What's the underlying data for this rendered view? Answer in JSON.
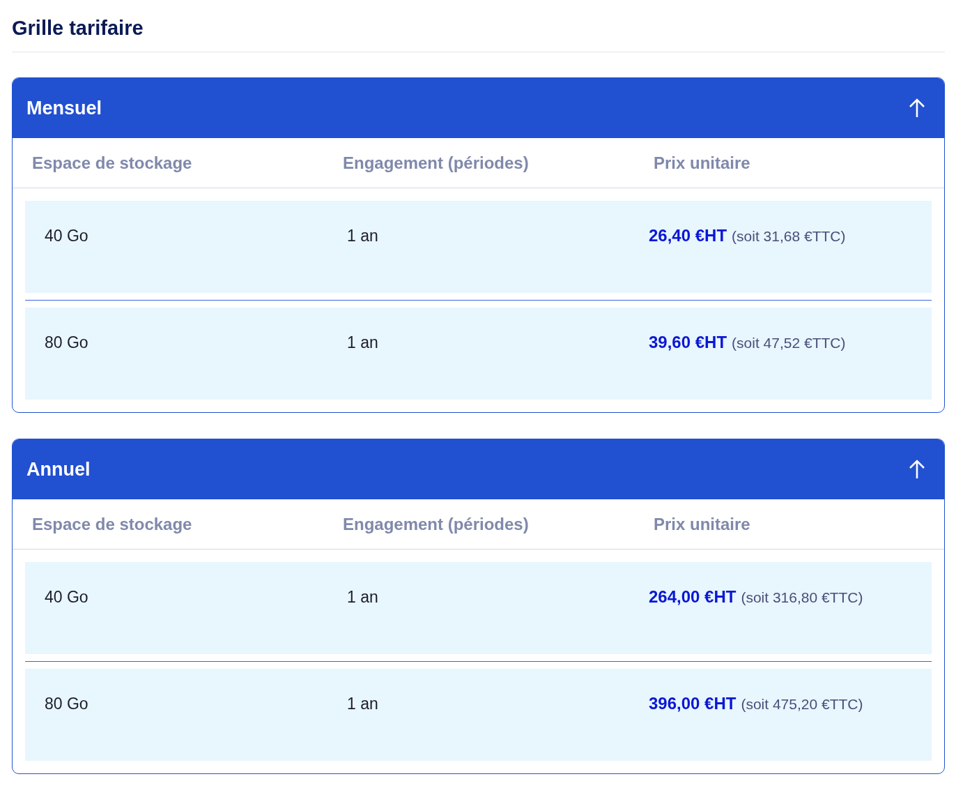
{
  "title": "Grille tarifaire",
  "panels": [
    {
      "title": "Mensuel",
      "expanded": true,
      "columns": [
        "Espace de stockage",
        "Engagement (périodes)",
        "Prix unitaire"
      ],
      "rows": [
        {
          "storage": "40 Go",
          "commitment": "1 an",
          "price": "26,40 €HT",
          "price_ttc": "(soit 31,68 €TTC)"
        },
        {
          "storage": "80 Go",
          "commitment": "1 an",
          "price": "39,60 €HT",
          "price_ttc": "(soit 47,52 €TTC)"
        }
      ]
    },
    {
      "title": "Annuel",
      "expanded": true,
      "columns": [
        "Espace de stockage",
        "Engagement (périodes)",
        "Prix unitaire"
      ],
      "rows": [
        {
          "storage": "40 Go",
          "commitment": "1 an",
          "price": "264,00 €HT",
          "price_ttc": "(soit 316,80 €TTC)"
        },
        {
          "storage": "80 Go",
          "commitment": "1 an",
          "price": "396,00 €HT",
          "price_ttc": "(soit 475,20 €TTC)"
        }
      ]
    }
  ]
}
